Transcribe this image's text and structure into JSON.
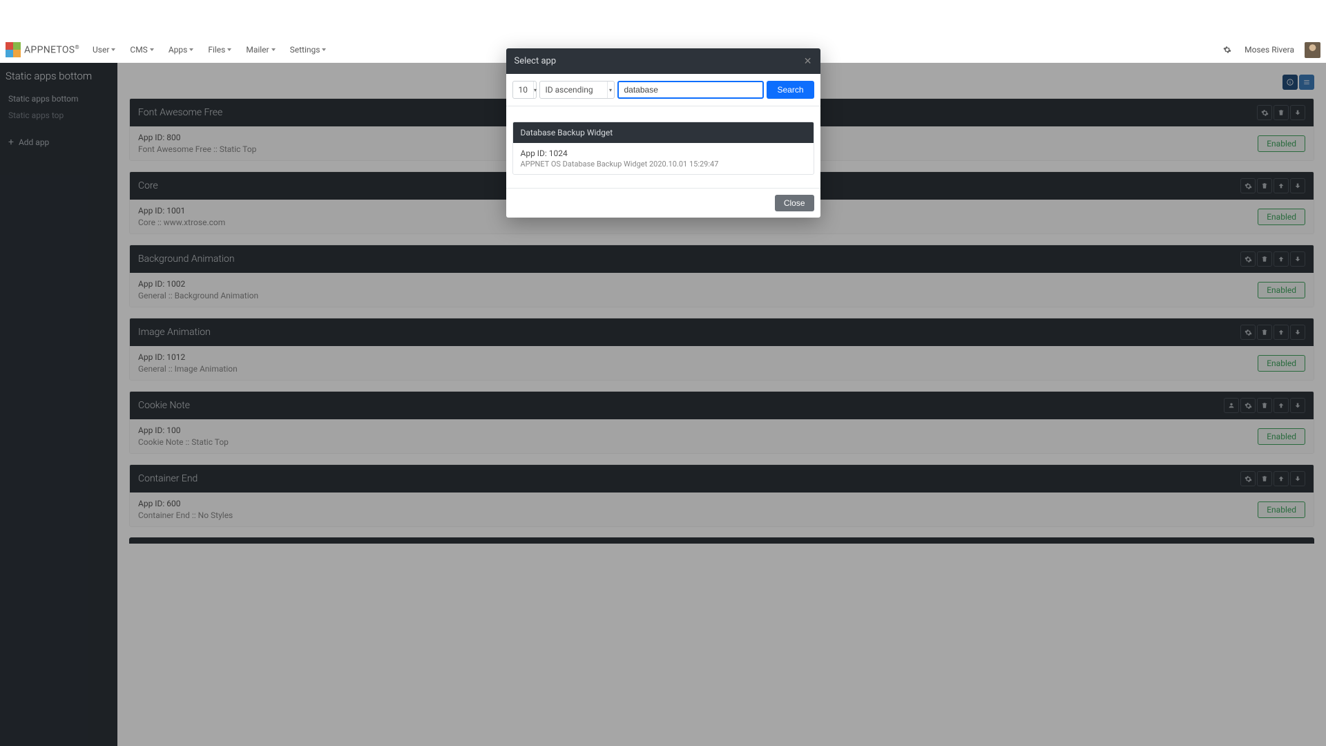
{
  "nav": {
    "logo": "APPNETOS",
    "reg": "®",
    "items": [
      "User",
      "CMS",
      "Apps",
      "Files",
      "Mailer",
      "Settings"
    ],
    "user_name": "Moses Rivera"
  },
  "sidebar": {
    "title": "Static apps bottom",
    "link1": "Static apps bottom",
    "link2": "Static apps top",
    "add_app": "Add app"
  },
  "modal": {
    "title": "Select app",
    "count": "10",
    "sort": "ID ascending",
    "search_value": "database",
    "search_btn": "Search",
    "result_title": "Database Backup Widget",
    "result_id": "App ID: 1024",
    "result_desc": "APPNET OS Database Backup Widget 2020.10.01 15:29:47",
    "close": "Close"
  },
  "cards": [
    {
      "title": "Font Awesome Free",
      "id": "App ID: 800",
      "desc": "Font Awesome Free :: Static Top",
      "up": false,
      "user": false
    },
    {
      "title": "Core",
      "id": "App ID: 1001",
      "desc": "Core :: www.xtrose.com",
      "up": true,
      "user": false
    },
    {
      "title": "Background Animation",
      "id": "App ID: 1002",
      "desc": "General :: Background Animation",
      "up": true,
      "user": false
    },
    {
      "title": "Image Animation",
      "id": "App ID: 1012",
      "desc": "General :: Image Animation",
      "up": true,
      "user": false
    },
    {
      "title": "Cookie Note",
      "id": "App ID: 100",
      "desc": "Cookie Note :: Static Top",
      "up": true,
      "user": true
    },
    {
      "title": "Container End",
      "id": "App ID: 600",
      "desc": "Container End :: No Styles",
      "up": true,
      "user": false
    }
  ],
  "enabled_label": "Enabled"
}
